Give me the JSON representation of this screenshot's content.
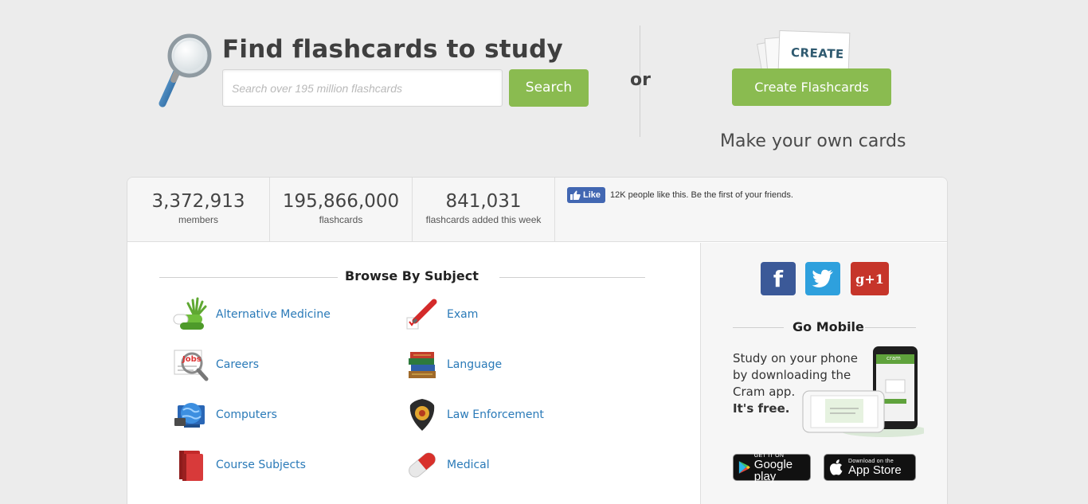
{
  "hero": {
    "title": "Find flashcards to study",
    "search_placeholder": "Search over 195 million flashcards",
    "search_button": "Search",
    "or_text": "or",
    "create_card_label": "CREATE",
    "create_button": "Create Flashcards",
    "make_own": "Make your own cards"
  },
  "stats": [
    {
      "value": "3,372,913",
      "label": "members"
    },
    {
      "value": "195,866,000",
      "label": "flashcards"
    },
    {
      "value": "841,031",
      "label": "flashcards added this week"
    }
  ],
  "facebook": {
    "like_label": "Like",
    "like_text": "12K people like this. Be the first of your friends."
  },
  "browse": {
    "heading": "Browse By Subject",
    "subjects_left": [
      {
        "label": "Alternative Medicine",
        "icon": "herbal-pill-icon"
      },
      {
        "label": "Careers",
        "icon": "jobs-magnifier-icon"
      },
      {
        "label": "Computers",
        "icon": "globe-computer-icon"
      },
      {
        "label": "Course Subjects",
        "icon": "books-icon"
      }
    ],
    "subjects_right": [
      {
        "label": "Exam",
        "icon": "exam-pen-icon"
      },
      {
        "label": "Language",
        "icon": "book-stack-icon"
      },
      {
        "label": "Law Enforcement",
        "icon": "police-badge-icon"
      },
      {
        "label": "Medical",
        "icon": "capsule-icon"
      }
    ]
  },
  "sidebar": {
    "social": [
      {
        "name": "facebook",
        "glyph": "f",
        "color": "#3b5998"
      },
      {
        "name": "twitter",
        "glyph": "t",
        "color": "#2ea0dd"
      },
      {
        "name": "google-plus",
        "glyph": "g+1",
        "color": "#c6352a"
      }
    ],
    "go_mobile_heading": "Go Mobile",
    "mobile_text": "Study on your phone by downloading the Cram app.",
    "mobile_free": "It's free.",
    "phone_app_label": "cram",
    "google_play": {
      "small": "GET IT ON",
      "big": "Google play"
    },
    "app_store": {
      "small": "Download on the",
      "big": "App Store"
    }
  },
  "colors": {
    "accent_green": "#8abb50",
    "link_blue": "#2a7ab8",
    "background": "#ececec"
  }
}
